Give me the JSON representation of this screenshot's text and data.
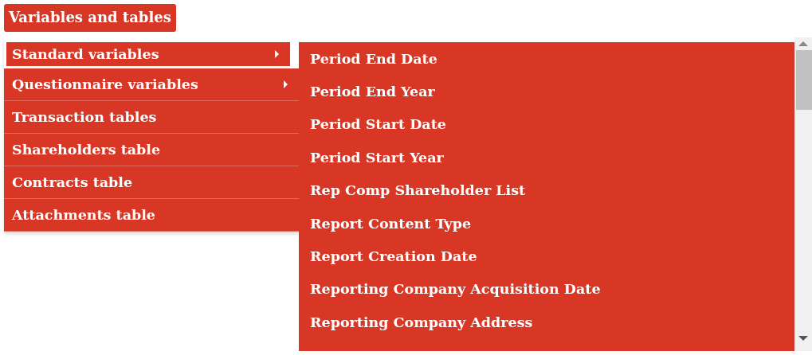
{
  "menu_button": {
    "label": "Variables and tables"
  },
  "menu": {
    "items": [
      {
        "label": "Standard variables",
        "has_submenu": true,
        "selected": true
      },
      {
        "label": "Questionnaire variables",
        "has_submenu": true,
        "selected": false
      },
      {
        "label": "Transaction tables",
        "has_submenu": false,
        "selected": false
      },
      {
        "label": "Shareholders table",
        "has_submenu": false,
        "selected": false
      },
      {
        "label": "Contracts table",
        "has_submenu": false,
        "selected": false
      },
      {
        "label": "Attachments table",
        "has_submenu": false,
        "selected": false
      }
    ]
  },
  "submenu": {
    "items": [
      "Period End Date",
      "Period End Year",
      "Period Start Date",
      "Period Start Year",
      "Rep Comp Shareholder List",
      "Report Content Type",
      "Report Creation Date",
      "Reporting Company Acquisition Date",
      "Reporting Company Address"
    ]
  }
}
